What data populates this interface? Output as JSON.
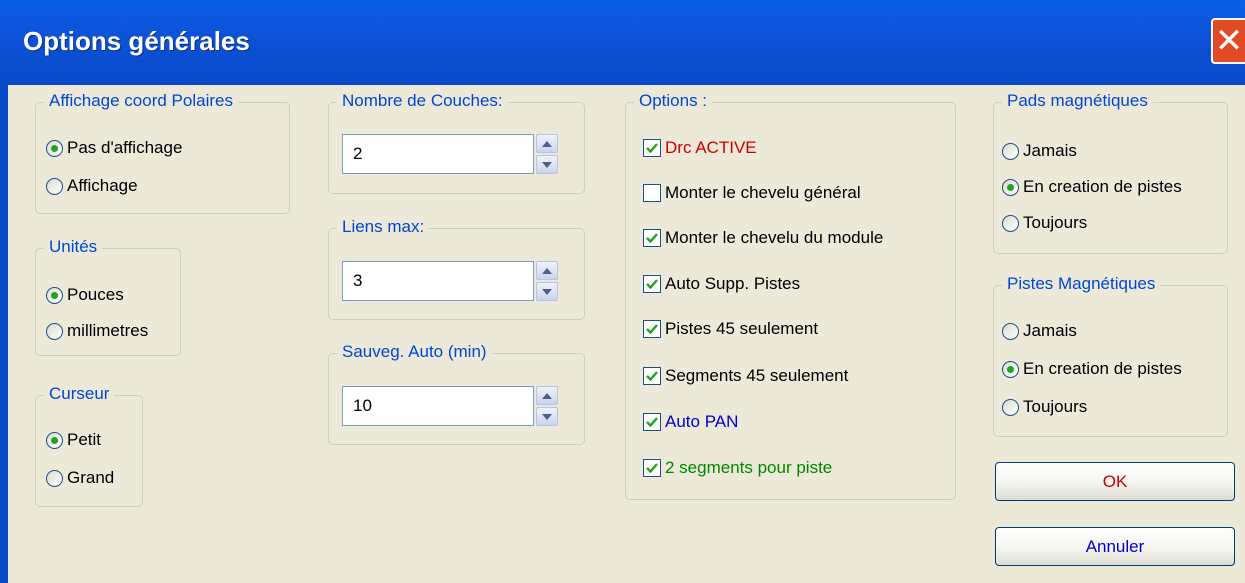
{
  "window": {
    "title": "Options générales",
    "close_glyph": "✕"
  },
  "polar": {
    "legend": "Affichage coord Polaires",
    "options": [
      "Pas d'affichage",
      "Affichage"
    ],
    "selected": 0
  },
  "units": {
    "legend": "Unités",
    "options": [
      "Pouces",
      "millimetres"
    ],
    "selected": 0
  },
  "cursor": {
    "legend": "Curseur",
    "options": [
      "Petit",
      "Grand"
    ],
    "selected": 0
  },
  "layers": {
    "legend": "Nombre de Couches:",
    "value": "2"
  },
  "links": {
    "legend": "Liens max:",
    "value": "3"
  },
  "autosave": {
    "legend": "Sauveg. Auto (min)",
    "value": "10"
  },
  "options": {
    "legend": "Options :",
    "items": [
      {
        "label": "Drc ACTIVE",
        "checked": true,
        "color": "#cc0000"
      },
      {
        "label": "Monter le chevelu général",
        "checked": false,
        "color": "#000000"
      },
      {
        "label": "Monter le chevelu du module",
        "checked": true,
        "color": "#000000"
      },
      {
        "label": "Auto Supp. Pistes",
        "checked": true,
        "color": "#000000"
      },
      {
        "label": "Pistes 45 seulement",
        "checked": true,
        "color": "#000000"
      },
      {
        "label": "Segments 45 seulement",
        "checked": true,
        "color": "#000000"
      },
      {
        "label": "Auto PAN",
        "checked": true,
        "color": "#0000cc"
      },
      {
        "label": "2 segments pour piste",
        "checked": true,
        "color": "#008800"
      }
    ]
  },
  "magnetic_pads": {
    "legend": "Pads magnétiques",
    "options": [
      "Jamais",
      "En creation de pistes",
      "Toujours"
    ],
    "selected": 1
  },
  "magnetic_tracks": {
    "legend": "Pistes Magnétiques",
    "options": [
      "Jamais",
      "En creation de pistes",
      "Toujours"
    ],
    "selected": 1
  },
  "buttons": {
    "ok": "OK",
    "ok_color": "#cc0000",
    "cancel": "Annuler",
    "cancel_color": "#0000cc"
  },
  "colors": {
    "legend": "#0046d5",
    "check_mark": "#21a121",
    "radio_dot": "#21a121"
  }
}
